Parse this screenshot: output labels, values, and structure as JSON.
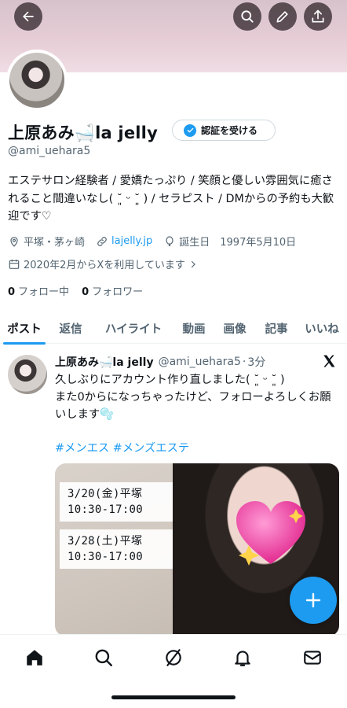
{
  "profile": {
    "name": "上原あみ🛁la jelly",
    "verify_label": "認証を受ける",
    "handle": "@ami_uehara5",
    "bio": "エステサロン経験者 / 愛嬌たっぷり / 笑顔と優しい雰囲気に癒されること間違いなし( ˘͈ ᵕ ˘͈ ) / セラピスト / DMからの予約も大歓迎です♡",
    "location": "平塚・茅ヶ崎",
    "website": "lajelly.jp",
    "birthday": "誕生日　1997年5月10日",
    "joined": "2020年2月からXを利用しています",
    "following_count": "0",
    "following_label": "フォロー中",
    "followers_count": "0",
    "followers_label": "フォロワー"
  },
  "tabs": [
    {
      "label": "ポスト"
    },
    {
      "label": "返信"
    },
    {
      "label": "ハイライト"
    },
    {
      "label": "動画"
    },
    {
      "label": "画像"
    },
    {
      "label": "記事"
    },
    {
      "label": "いいね"
    }
  ],
  "post": {
    "name": "上原あみ🛁la jelly",
    "handle": "@ami_uehara5",
    "time": "3分",
    "text_line1": "久しぶりにアカウント作り直しました( ˘͈ ᵕ ˘͈ )",
    "text_line2": "また0からになっちゃったけど、フォローよろしくお願いします🫧",
    "hashtags": "#メンエス #メンズエステ",
    "schedule": [
      {
        "date": "3/20(金)平塚",
        "time": "10:30-17:00"
      },
      {
        "date": "3/28(土)平塚",
        "time": "10:30-17:00"
      }
    ]
  },
  "icons": {
    "back": "back-arrow-icon",
    "search": "search-icon",
    "edit": "pencil-icon",
    "share": "share-icon"
  },
  "colors": {
    "accent": "#1d9bf0",
    "text": "#0f1419",
    "secondary": "#536471"
  }
}
